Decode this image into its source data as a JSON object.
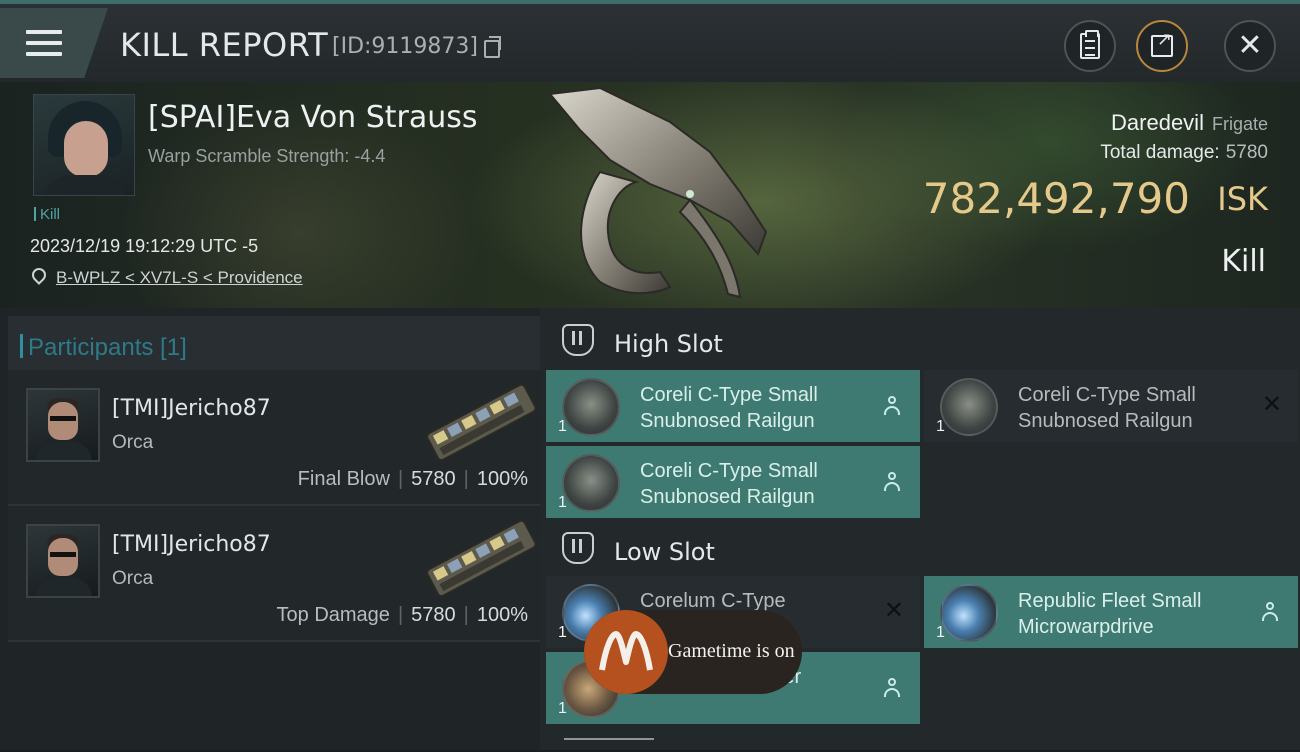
{
  "header": {
    "title": "KILL REPORT",
    "report_id": "[ID:9119873]",
    "icons": [
      "menu-icon",
      "copy-icon",
      "clipboard-icon",
      "share-icon",
      "close-icon"
    ]
  },
  "victim": {
    "name": "[SPAI]Eva Von Strauss",
    "warp_scramble": "Warp Scramble Strength: -4.4",
    "tag": "Kill",
    "datetime": "2023/12/19 19:12:29 UTC -5",
    "location": "B-WPLZ < XV7L-S < Providence",
    "ship_name": "Daredevil",
    "ship_class": "Frigate",
    "total_damage_label": "Total damage:",
    "total_damage_value": "5780",
    "isk_value": "782,492,790",
    "isk_unit": "ISK",
    "result": "Kill"
  },
  "participants": {
    "heading": "Participants [1]",
    "rows": [
      {
        "name": "[TMI]Jericho87",
        "ship": "Orca",
        "label": "Final Blow",
        "damage": "5780",
        "percent": "100%"
      },
      {
        "name": "[TMI]Jericho87",
        "ship": "Orca",
        "label": "Top Damage",
        "damage": "5780",
        "percent": "100%"
      }
    ]
  },
  "fitting": {
    "high_slot": {
      "title": "High Slot",
      "modules": [
        {
          "name": "Coreli C-Type Small Snubnosed Railgun",
          "qty": "1",
          "state": "dropped"
        },
        {
          "name": "Coreli C-Type Small Snubnosed Railgun",
          "qty": "1",
          "state": "destroyed"
        },
        {
          "name": "Coreli C-Type Small Snubnosed Railgun",
          "qty": "1",
          "state": "dropped"
        }
      ]
    },
    "low_slot": {
      "title": "Low Slot",
      "modules": [
        {
          "name": "Corelum C-Type",
          "qty": "1",
          "state": "destroyed"
        },
        {
          "name": "Republic Fleet Small Microwarpdrive",
          "qty": "1",
          "state": "dropped"
        },
        {
          "name": "all Armor Repairer",
          "qty": "1",
          "state": "dropped"
        }
      ]
    }
  },
  "toast": {
    "text": "Gametime is on"
  },
  "colors": {
    "accent": "#3f7a72",
    "isk": "#e4c98a",
    "participants_heading": "#2f7a89",
    "toast_logo": "#b4511f"
  }
}
